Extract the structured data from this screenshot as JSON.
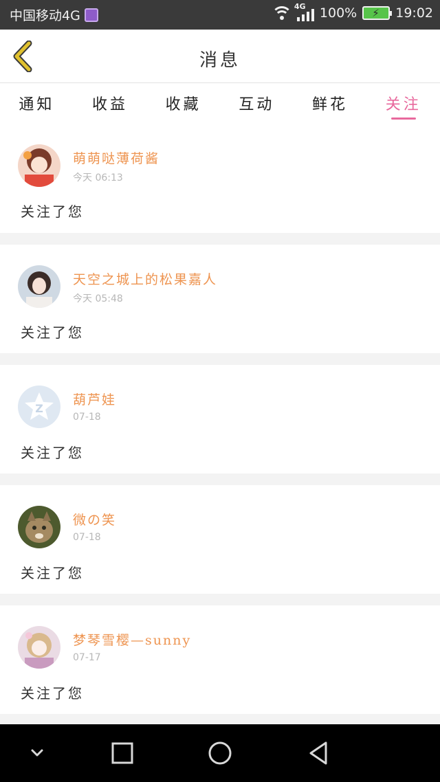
{
  "status_bar": {
    "carrier": "中国移动4G",
    "network_tag": "4G",
    "battery": "100%",
    "time": "19:02"
  },
  "header": {
    "title": "消息"
  },
  "tabs": [
    {
      "label": "通知",
      "active": false
    },
    {
      "label": "收益",
      "active": false
    },
    {
      "label": "收藏",
      "active": false
    },
    {
      "label": "互动",
      "active": false
    },
    {
      "label": "鲜花",
      "active": false
    },
    {
      "label": "关注",
      "active": true
    }
  ],
  "messages": [
    {
      "name": "萌萌哒薄荷酱",
      "time": "今天 06:13",
      "text": "关注了您"
    },
    {
      "name": "天空之城上的松果嘉人",
      "time": "今天 05:48",
      "text": "关注了您"
    },
    {
      "name": "葫芦娃",
      "time": "07-18",
      "text": "关注了您"
    },
    {
      "name": "微の笑",
      "time": "07-18",
      "text": "关注了您"
    },
    {
      "name": "梦琴雪樱—sunny",
      "time": "07-17",
      "text": "关注了您"
    }
  ],
  "colors": {
    "accent": "#e8699d",
    "name": "#ee9450",
    "back_arrow": "#e0c12f"
  }
}
